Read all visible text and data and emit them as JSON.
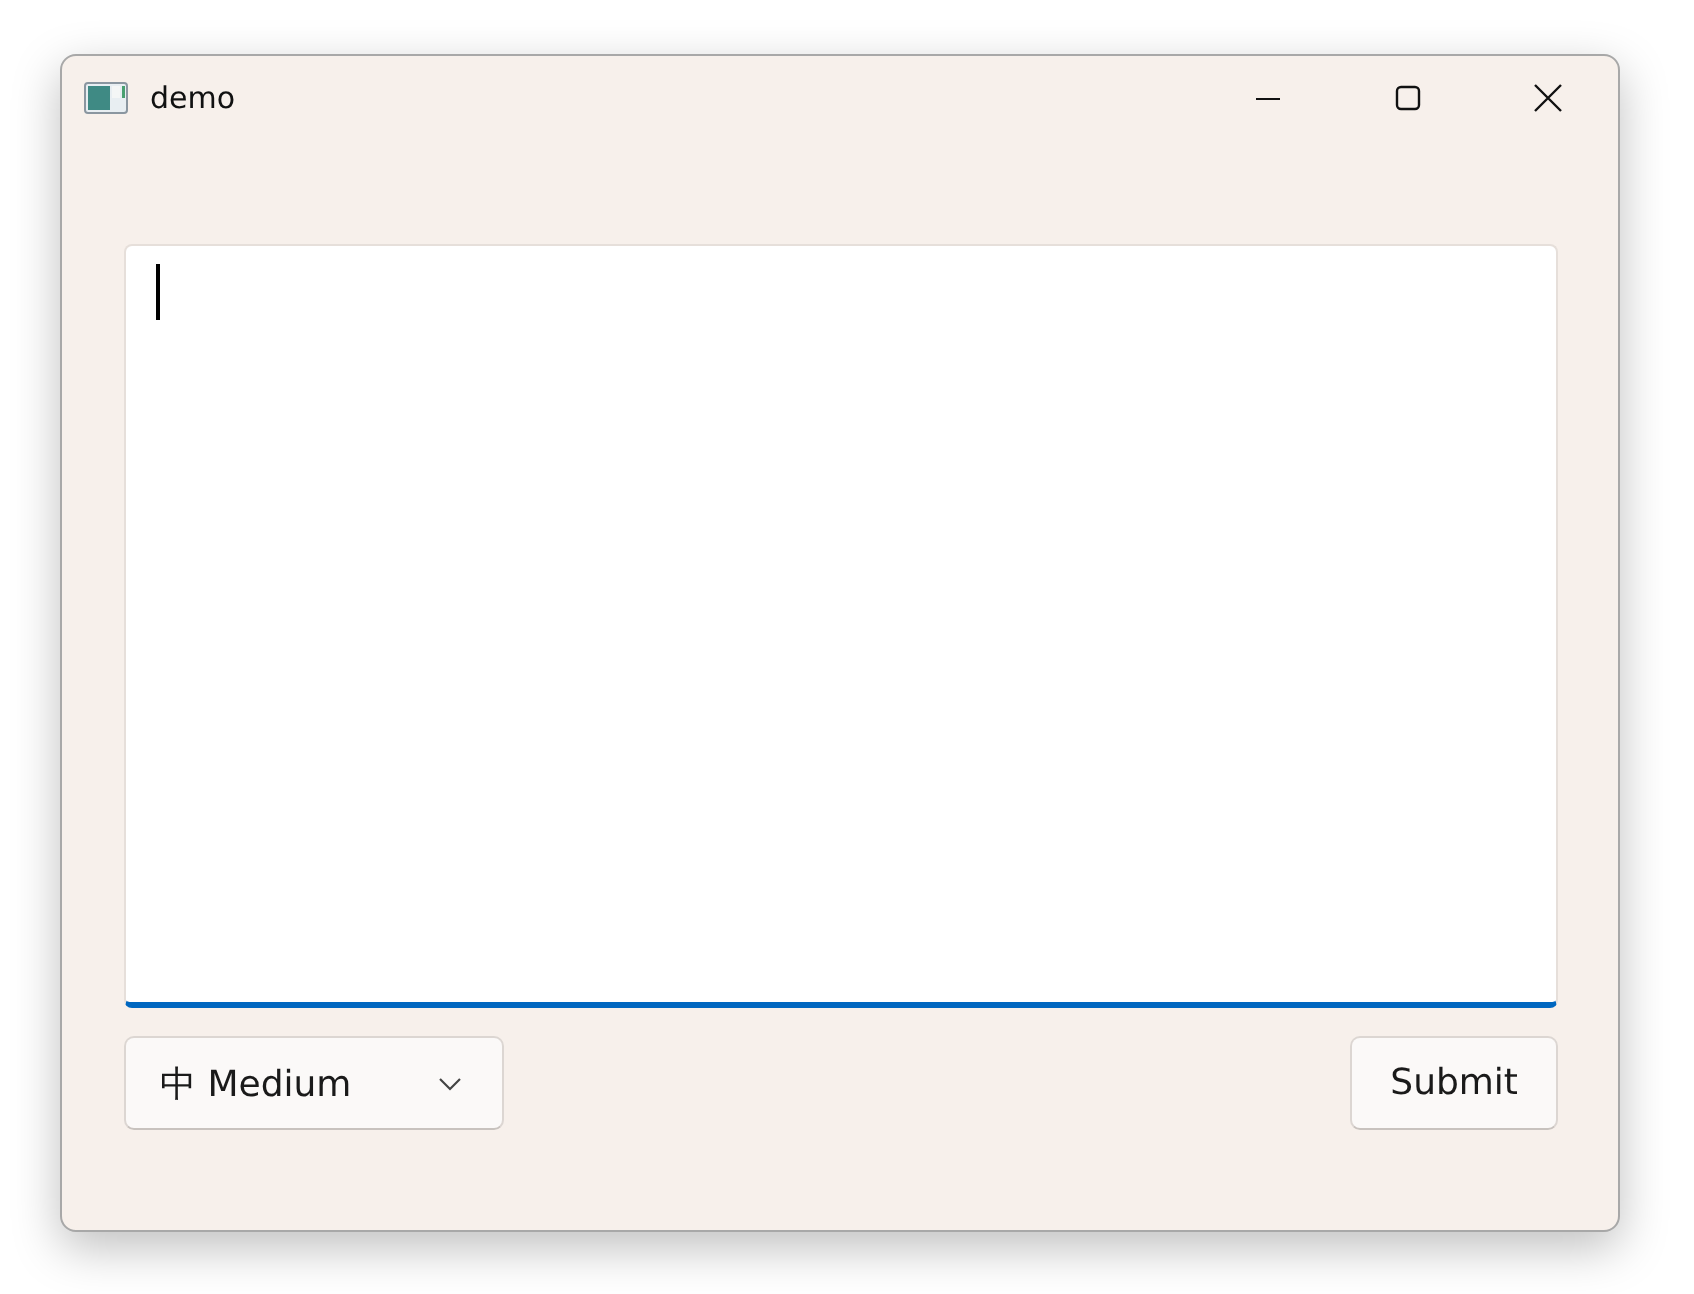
{
  "window": {
    "title": "demo"
  },
  "editor": {
    "focused": true
  },
  "dropdown": {
    "value": "中 Medium"
  },
  "buttons": [
    "Submit"
  ]
}
